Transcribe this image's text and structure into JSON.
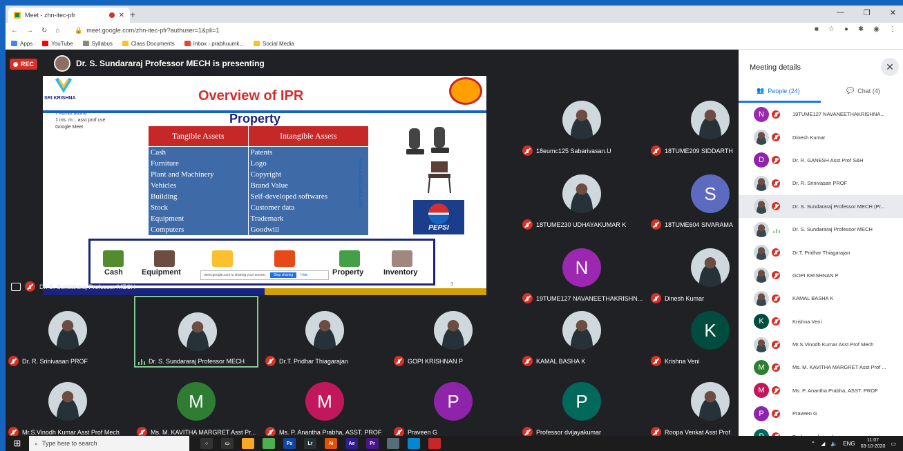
{
  "browser": {
    "tab_title": "Meet - zhn-itec-pfr",
    "url": "meet.google.com/zhn-itec-pfr?authuser=1&pli=1",
    "bookmarks": [
      "Apps",
      "YouTube",
      "Syllabus",
      "Class Documents",
      "Inbox - prabhuumk...",
      "Social Media"
    ]
  },
  "meeting": {
    "rec_label": "REC",
    "presenting_text": "Dr. S. Sundararaj Professor MECH is presenting",
    "presenter_tile_label": "Dr. S. Sundararaj Professor MECH"
  },
  "slide": {
    "title": "Overview of IPR",
    "subtitle": "Property",
    "col_tangible": "Tangible Assets",
    "col_intangible": "Intangible Assets",
    "rows": [
      [
        "Cash",
        "Patents"
      ],
      [
        "Furniture",
        "Logo"
      ],
      [
        "Plant and Machinery",
        "Copyright"
      ],
      [
        "Vehicles",
        "Brand Value"
      ],
      [
        "Building",
        "Self-developed softwares"
      ],
      [
        "Stock",
        "Customer data"
      ],
      [
        "Equipment",
        "Trademark"
      ],
      [
        "Computers",
        "Goodwill"
      ]
    ],
    "side_tag": "AccountingCaptial.com",
    "pepsi": "PEPSI",
    "icon_labels": [
      "Cash",
      "Equipment",
      "Property",
      "Inventory"
    ],
    "page_no": "3",
    "share_notice": "meet.google.com is sharing your screen.",
    "share_stop": "Stop sharing",
    "share_hide": "Hide",
    "logo_text": "SRI KRISHNA",
    "overlay_lines": [
      "7 kamal basha",
      "1 ms. m...    asst prof cse",
      "Google Meet"
    ]
  },
  "tiles": [
    {
      "name": "18eumc125 Sabarivasan.U",
      "avatar": "photo"
    },
    {
      "name": "18TUME209 SIDDARTH",
      "avatar": "photo"
    },
    {
      "name": "18TUME230 UDHAYAKUMAR K",
      "avatar": "photo"
    },
    {
      "name": "18TUME604 SIVARAMA",
      "avatar": "S",
      "color": "#5c6bc0"
    },
    {
      "name": "19TUME127 NAVANEETHAKRISHN...",
      "avatar": "N",
      "color": "#9c27b0"
    },
    {
      "name": "Dinesh Kumar",
      "avatar": "photo"
    },
    {
      "name": "Dr. R. Srinivasan PROF",
      "avatar": "photo"
    },
    {
      "name": "Dr. S. Sundararaj Professor MECH",
      "avatar": "photo"
    },
    {
      "name": "Dr.T. Pridhar Thiagarajan",
      "avatar": "photo"
    },
    {
      "name": "GOPI KRISHNAN P",
      "avatar": "photo"
    },
    {
      "name": "KAMAL BASHA K",
      "avatar": "photo"
    },
    {
      "name": "Krishna Veni",
      "avatar": "K",
      "color": "#004d40"
    },
    {
      "name": "Mr.S.Vinodh Kumar Asst Prof Mech",
      "avatar": "photo"
    },
    {
      "name": "Ms. M. KAVITHA MARGRET Asst Pr...",
      "avatar": "M",
      "color": "#2e7d32"
    },
    {
      "name": "Ms. P. Anantha Prabha, ASST. PROF",
      "avatar": "M",
      "color": "#c2185b"
    },
    {
      "name": "Praveen G",
      "avatar": "P",
      "color": "#8e24aa"
    },
    {
      "name": "Professor dvijayakumar",
      "avatar": "P",
      "color": "#00695c"
    },
    {
      "name": "Roopa Venkat Asst Prof",
      "avatar": "photo"
    }
  ],
  "panel": {
    "title": "Meeting details",
    "people_tab": "People (24)",
    "chat_tab": "Chat (4)",
    "people": [
      {
        "name": "19TUME127 NAVANEETHAKRISHNA...",
        "avatar": "N",
        "color": "#9c27b0"
      },
      {
        "name": "Dinesh Kumar",
        "avatar": "photo"
      },
      {
        "name": "Dr. R. GANESH Asst Prof S&H",
        "avatar": "D",
        "color": "#8e24aa"
      },
      {
        "name": "Dr. R. Srinivasan PROF",
        "avatar": "photo"
      },
      {
        "name": "Dr. S. Sundararaj Professor MECH (Pr...",
        "avatar": "photo"
      },
      {
        "name": "Dr. S. Sundararaj Professor MECH",
        "avatar": "photo"
      },
      {
        "name": "Dr.T. Pridhar Thiagarajan",
        "avatar": "photo"
      },
      {
        "name": "GOPI KRISHNAN P",
        "avatar": "photo"
      },
      {
        "name": "KAMAL BASHA K",
        "avatar": "photo"
      },
      {
        "name": "Krishna Veni",
        "avatar": "K",
        "color": "#004d40"
      },
      {
        "name": "Mr.S.Vinodh Kumar Asst Prof Mech",
        "avatar": "photo"
      },
      {
        "name": "Ms. M. KAVITHA MARGRET Asst Prof ...",
        "avatar": "M",
        "color": "#2e7d32"
      },
      {
        "name": "Ms. P. Anantha Prabha, ASST. PROF",
        "avatar": "M",
        "color": "#c2185b"
      },
      {
        "name": "Praveen G",
        "avatar": "P",
        "color": "#8e24aa"
      },
      {
        "name": "Professor dvijayakumar",
        "avatar": "P",
        "color": "#00695c"
      }
    ]
  },
  "taskbar": {
    "search_placeholder": "Type here to search",
    "lang": "ENG",
    "time": "11:07",
    "date": "03-10-2020"
  }
}
